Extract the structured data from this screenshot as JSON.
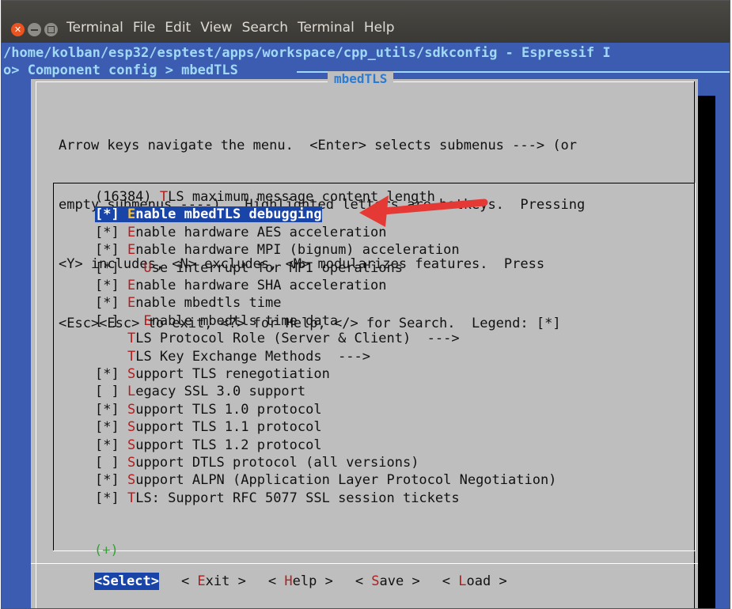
{
  "window": {
    "close_glyph": "✕",
    "menus": [
      "Terminal",
      "File",
      "Edit",
      "View",
      "Search",
      "Terminal",
      "Help"
    ]
  },
  "terminal": {
    "path_line": "/home/kolban/esp32/esptest/apps/workspace/cpp_utils/sdkconfig - Espressif I",
    "crumb_line": "o> Component config > mbedTLS "
  },
  "dialog": {
    "title": "mbedTLS",
    "help_lines": [
      "Arrow keys navigate the menu.  <Enter> selects submenus ---> (or",
      "empty submenus ----).  Highlighted letters are hotkeys.  Pressing",
      "<Y> includes, <N> excludes, <M> modularizes features.  Press",
      "<Esc><Esc> to exit, <?> for Help, </> for Search.  Legend: [*]"
    ],
    "items": [
      {
        "prefix": "(16384) ",
        "hotkey": "T",
        "rest": "LS maximum message content length",
        "selected": false
      },
      {
        "prefix": "[*] ",
        "hotkey": "E",
        "rest": "nable mbedTLS debugging",
        "selected": true
      },
      {
        "prefix": "[*] ",
        "hotkey": "E",
        "rest": "nable hardware AES acceleration",
        "selected": false
      },
      {
        "prefix": "[*] ",
        "hotkey": "E",
        "rest": "nable hardware MPI (bignum) acceleration",
        "selected": false
      },
      {
        "prefix": "[*]   ",
        "hotkey": "U",
        "rest": "se interrupt for MPI operations",
        "selected": false
      },
      {
        "prefix": "[*] ",
        "hotkey": "E",
        "rest": "nable hardware SHA acceleration",
        "selected": false
      },
      {
        "prefix": "[*] ",
        "hotkey": "E",
        "rest": "nable mbedtls time",
        "selected": false
      },
      {
        "prefix": "[ ]   ",
        "hotkey": "E",
        "rest": "nable mbedtls time data",
        "selected": false
      },
      {
        "prefix": "    ",
        "hotkey": "T",
        "rest": "LS Protocol Role (Server & Client)  --->",
        "selected": false
      },
      {
        "prefix": "    ",
        "hotkey": "T",
        "rest": "LS Key Exchange Methods  --->",
        "selected": false
      },
      {
        "prefix": "[*] ",
        "hotkey": "S",
        "rest": "upport TLS renegotiation",
        "selected": false
      },
      {
        "prefix": "[ ] ",
        "hotkey": "L",
        "rest": "egacy SSL 3.0 support",
        "selected": false
      },
      {
        "prefix": "[*] ",
        "hotkey": "S",
        "rest": "upport TLS 1.0 protocol",
        "selected": false
      },
      {
        "prefix": "[*] ",
        "hotkey": "S",
        "rest": "upport TLS 1.1 protocol",
        "selected": false
      },
      {
        "prefix": "[*] ",
        "hotkey": "S",
        "rest": "upport TLS 1.2 protocol",
        "selected": false
      },
      {
        "prefix": "[ ] ",
        "hotkey": "S",
        "rest": "upport DTLS protocol (all versions)",
        "selected": false
      },
      {
        "prefix": "[*] ",
        "hotkey": "S",
        "rest": "upport ALPN (Application Layer Protocol Negotiation)",
        "selected": false
      },
      {
        "prefix": "[*] ",
        "hotkey": "T",
        "rest": "LS: Support RFC 5077 SSL session tickets",
        "selected": false
      }
    ],
    "more_indicator": "(+)",
    "buttons": [
      {
        "open": "<",
        "hotkey": "S",
        "rest": "elect",
        "close": ">",
        "active": true
      },
      {
        "open": "< ",
        "hotkey": "E",
        "rest": "xit",
        "close": " >",
        "active": false
      },
      {
        "open": "< ",
        "hotkey": "H",
        "rest": "elp",
        "close": " >",
        "active": false
      },
      {
        "open": "< ",
        "hotkey": "S",
        "rest": "ave",
        "close": " >",
        "active": false
      },
      {
        "open": "< ",
        "hotkey": "L",
        "rest": "oad",
        "close": " >",
        "active": false
      }
    ]
  },
  "colors": {
    "terminal_bg": "#3c5cb2",
    "dialog_bg": "#bebebe",
    "highlight": "#1a45a8",
    "hotkey": "#b51c1c",
    "annotation_arrow": "#e53935"
  }
}
